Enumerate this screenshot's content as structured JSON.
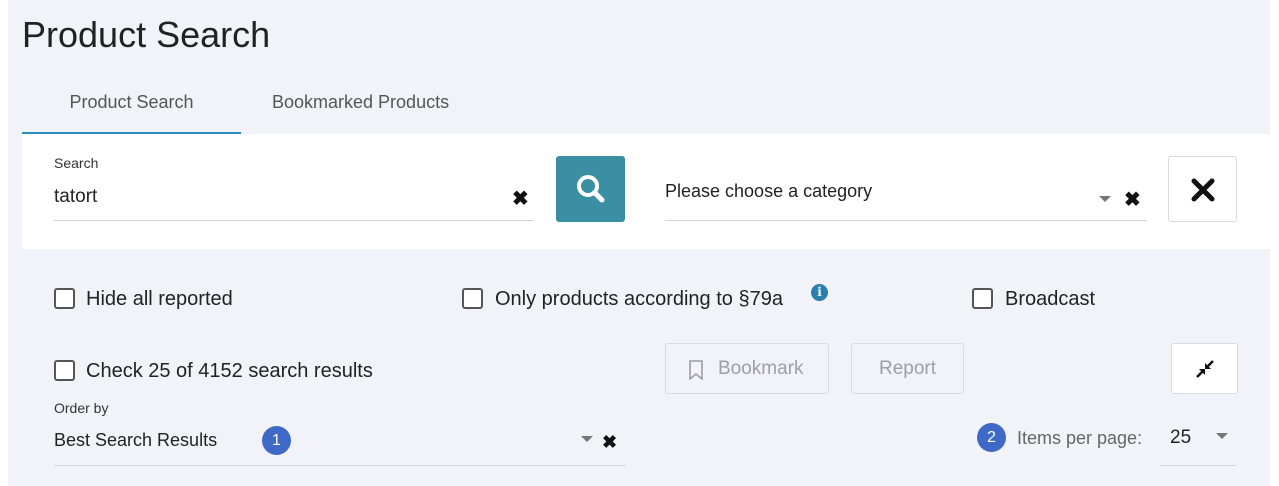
{
  "page": {
    "title": "Product Search"
  },
  "tabs": [
    {
      "label": "Product Search",
      "active": true
    },
    {
      "label": "Bookmarked Products",
      "active": false
    }
  ],
  "search": {
    "label": "Search",
    "value": "tatort",
    "clear_icon": "close-icon",
    "button_icon": "search-icon"
  },
  "category": {
    "placeholder": "Please choose a category",
    "clear_icon": "close-icon"
  },
  "reset_button": {
    "icon": "close-icon"
  },
  "filters": {
    "hide_reported": {
      "label": "Hide all reported",
      "checked": false
    },
    "only_79a": {
      "label": "Only products according to §79a",
      "checked": false,
      "info_icon": "info-icon"
    },
    "broadcast": {
      "label": "Broadcast",
      "checked": false
    }
  },
  "bulk": {
    "check_label": "Check 25 of 4152 search results",
    "checked": false,
    "bookmark_label": "Bookmark",
    "report_label": "Report",
    "compress_icon": "compress-icon"
  },
  "order": {
    "label": "Order by",
    "value": "Best Search Results",
    "badge": "1"
  },
  "pagination": {
    "badge": "2",
    "label": "Items per page:",
    "value": "25"
  },
  "colors": {
    "accent": "#3b8fa3",
    "tab_underline": "#2b8cba",
    "badge": "#3f69c6",
    "background": "#f1f3f8"
  }
}
